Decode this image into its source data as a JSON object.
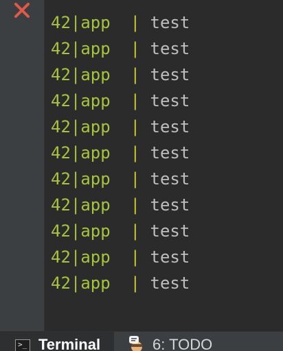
{
  "toolbar": {
    "close_icon": "close-x-icon",
    "close_color": "#e1594a"
  },
  "terminal": {
    "lines": [
      {
        "prefix": "42|app",
        "sep": "|",
        "message": "test"
      },
      {
        "prefix": "42|app",
        "sep": "|",
        "message": "test"
      },
      {
        "prefix": "42|app",
        "sep": "|",
        "message": "test"
      },
      {
        "prefix": "42|app",
        "sep": "|",
        "message": "test"
      },
      {
        "prefix": "42|app",
        "sep": "|",
        "message": "test"
      },
      {
        "prefix": "42|app",
        "sep": "|",
        "message": "test"
      },
      {
        "prefix": "42|app",
        "sep": "|",
        "message": "test"
      },
      {
        "prefix": "42|app",
        "sep": "|",
        "message": "test"
      },
      {
        "prefix": "42|app",
        "sep": "|",
        "message": "test"
      },
      {
        "prefix": "42|app",
        "sep": "|",
        "message": "test"
      },
      {
        "prefix": "42|app",
        "sep": "|",
        "message": "test"
      }
    ],
    "colors": {
      "prefix": "#a7c53a",
      "separator": "#c8c32d",
      "message": "#bfbfbf",
      "background": "#2b2b2b"
    }
  },
  "bottom_tabs": {
    "terminal": {
      "label": "Terminal",
      "icon": "terminal-icon",
      "icon_glyph": ">_"
    },
    "todo": {
      "label": "6: TODO",
      "icon": "todo-icon"
    }
  }
}
